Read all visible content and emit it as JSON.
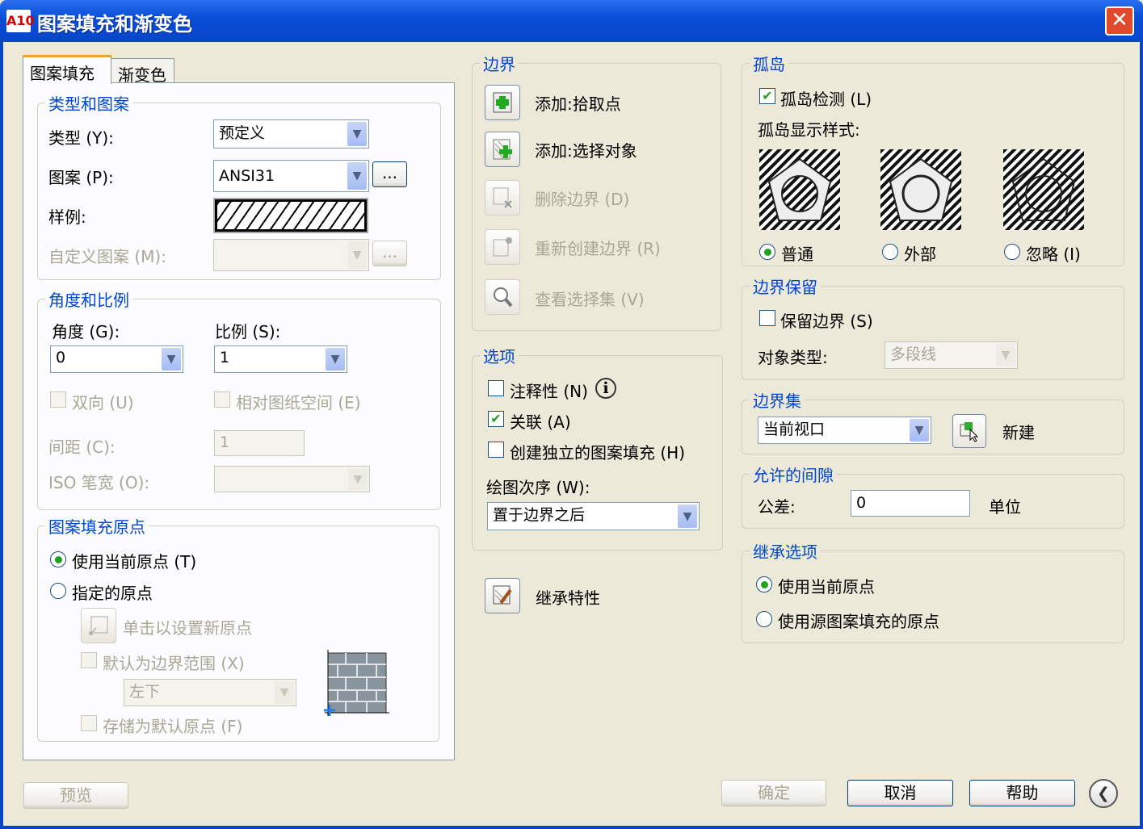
{
  "window": {
    "title": "图案填充和渐变色",
    "app_icon": "A10"
  },
  "tabs": [
    {
      "label": "图案填充",
      "active": true
    },
    {
      "label": "渐变色",
      "active": false
    }
  ],
  "type_pattern": {
    "legend": "类型和图案",
    "type_label": "类型 (Y):",
    "type_value": "预定义",
    "pattern_label": "图案 (P):",
    "pattern_value": "ANSI31",
    "browse": "...",
    "swatch_label": "样例:",
    "custom_label": "自定义图案 (M):",
    "custom_browse": "..."
  },
  "angle_scale": {
    "legend": "角度和比例",
    "angle_label": "角度 (G):",
    "angle_value": "0",
    "scale_label": "比例 (S):",
    "scale_value": "1",
    "double_label": "双向 (U)",
    "relative_label": "相对图纸空间 (E)",
    "spacing_label": "间距 (C):",
    "spacing_value": "1",
    "iso_label": "ISO 笔宽 (O):"
  },
  "origin": {
    "legend": "图案填充原点",
    "use_current": "使用当前原点 (T)",
    "specified": "指定的原点",
    "click_set": "单击以设置新原点",
    "default_extents": "默认为边界范围 (X)",
    "position_value": "左下",
    "store_default": "存储为默认原点 (F)"
  },
  "boundaries": {
    "legend": "边界",
    "items": [
      {
        "label": "添加:拾取点",
        "enabled": true
      },
      {
        "label": "添加:选择对象",
        "enabled": true
      },
      {
        "label": "删除边界 (D)",
        "enabled": false
      },
      {
        "label": "重新创建边界 (R)",
        "enabled": false
      },
      {
        "label": "查看选择集 (V)",
        "enabled": false
      }
    ]
  },
  "options": {
    "legend": "选项",
    "annotative": "注释性 (N)",
    "associative": "关联 (A)",
    "associative_checked": true,
    "separate": "创建独立的图案填充 (H)",
    "draw_order_label": "绘图次序 (W):",
    "draw_order_value": "置于边界之后"
  },
  "inherit": {
    "label": "继承特性"
  },
  "islands": {
    "legend": "孤岛",
    "detect": "孤岛检测 (L)",
    "detect_checked": true,
    "style_label": "孤岛显示样式:",
    "styles": [
      {
        "label": "普通",
        "selected": true
      },
      {
        "label": "外部",
        "selected": false
      },
      {
        "label": "忽略 (I)",
        "selected": false
      }
    ]
  },
  "retention": {
    "legend": "边界保留",
    "retain": "保留边界 (S)",
    "object_type_label": "对象类型:",
    "object_type_value": "多段线"
  },
  "boundary_set": {
    "legend": "边界集",
    "value": "当前视口",
    "new_label": "新建"
  },
  "gap": {
    "legend": "允许的间隙",
    "tolerance_label": "公差:",
    "tolerance_value": "0",
    "unit": "单位"
  },
  "inherit_options": {
    "legend": "继承选项",
    "use_current": "使用当前原点",
    "use_source": "使用源图案填充的原点"
  },
  "footer": {
    "preview": "预览",
    "ok": "确定",
    "cancel": "取消",
    "help": "帮助",
    "collapse": "❮"
  },
  "colors": {
    "legend": "#0046d5",
    "titlebar": "#0a4fd8",
    "check": "#21a121"
  }
}
